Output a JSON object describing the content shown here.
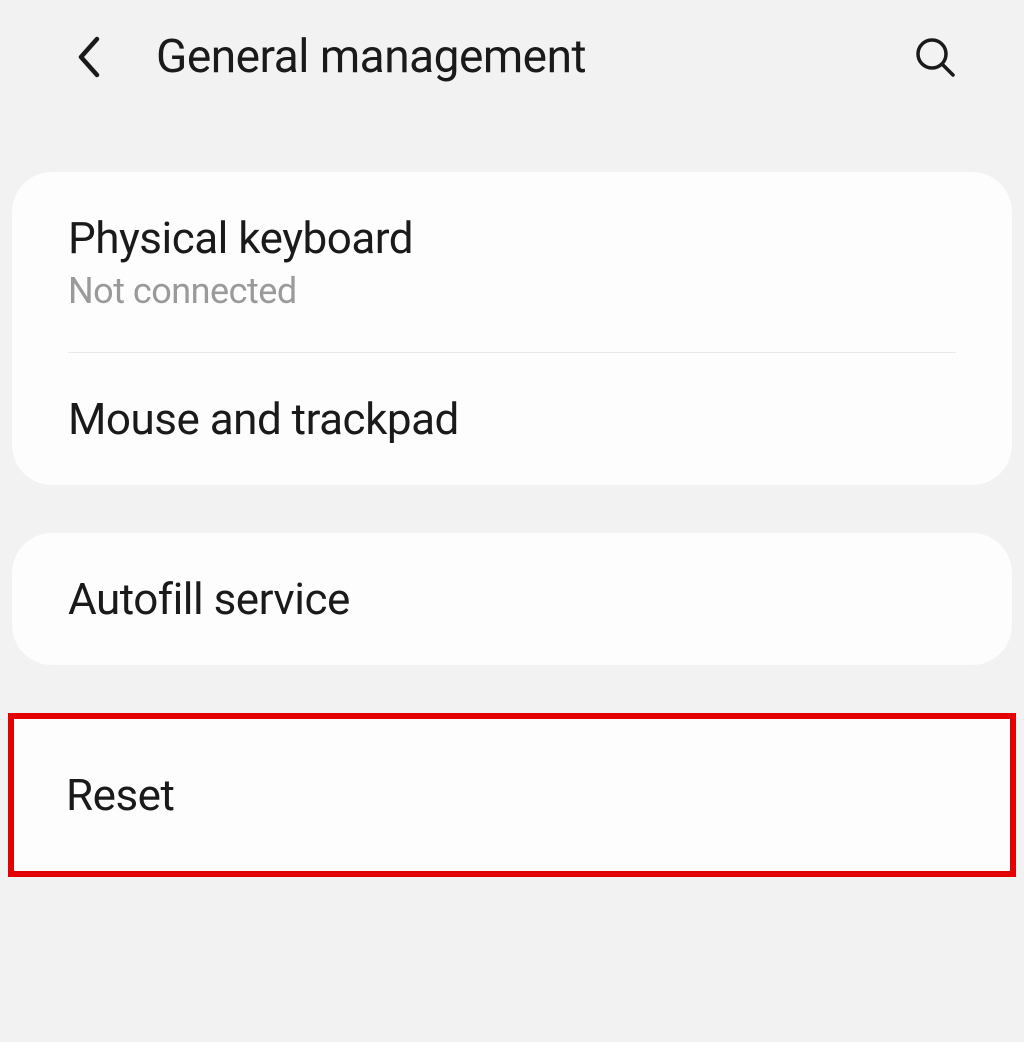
{
  "header": {
    "title": "General management"
  },
  "group1": {
    "items": [
      {
        "title": "Physical keyboard",
        "subtitle": "Not connected"
      },
      {
        "title": "Mouse and trackpad"
      }
    ]
  },
  "group2": {
    "items": [
      {
        "title": "Autofill service"
      }
    ]
  },
  "group3": {
    "items": [
      {
        "title": "Reset"
      }
    ]
  }
}
